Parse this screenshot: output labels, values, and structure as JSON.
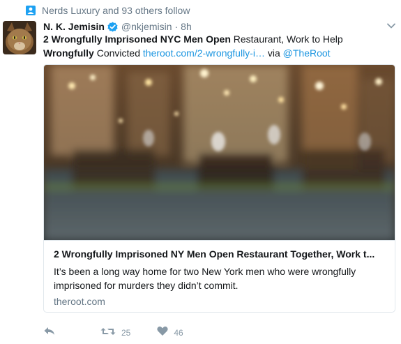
{
  "social_context": {
    "text": "Nerds Luxury and 93 others follow",
    "icon": "person-icon",
    "icon_color": "#1da1f2"
  },
  "tweet": {
    "author_name": "N. K. Jemisin",
    "handle": "@nkjemisin",
    "separator": "·",
    "time": "8h",
    "text": {
      "bold_1": "2 Wrongfully Imprisoned NYC Men Open",
      "plain_1": " Restaurant, Work to Help ",
      "bold_2": "Wrongfully",
      "plain_2": " Convicted ",
      "link": "theroot.com/2-wrongfully-i…",
      "via": " via ",
      "mention": "@TheRoot"
    }
  },
  "card": {
    "title": "2 Wrongfully Imprisoned NY Men Open Restaurant Together, Work t...",
    "description": "It’s been a long way home for two New York men who were wrongfully imprisoned for murders they didn’t commit.",
    "domain": "theroot.com",
    "image_alt": "blurred restaurant interior"
  },
  "actions": {
    "reply_icon": "reply-icon",
    "retweet_icon": "retweet-icon",
    "retweet_count": "25",
    "like_icon": "heart-icon",
    "like_count": "46"
  },
  "colors": {
    "link": "#1b95e0",
    "muted": "#657786",
    "verified": "#1da1f2",
    "action_gray": "#8899a6"
  }
}
